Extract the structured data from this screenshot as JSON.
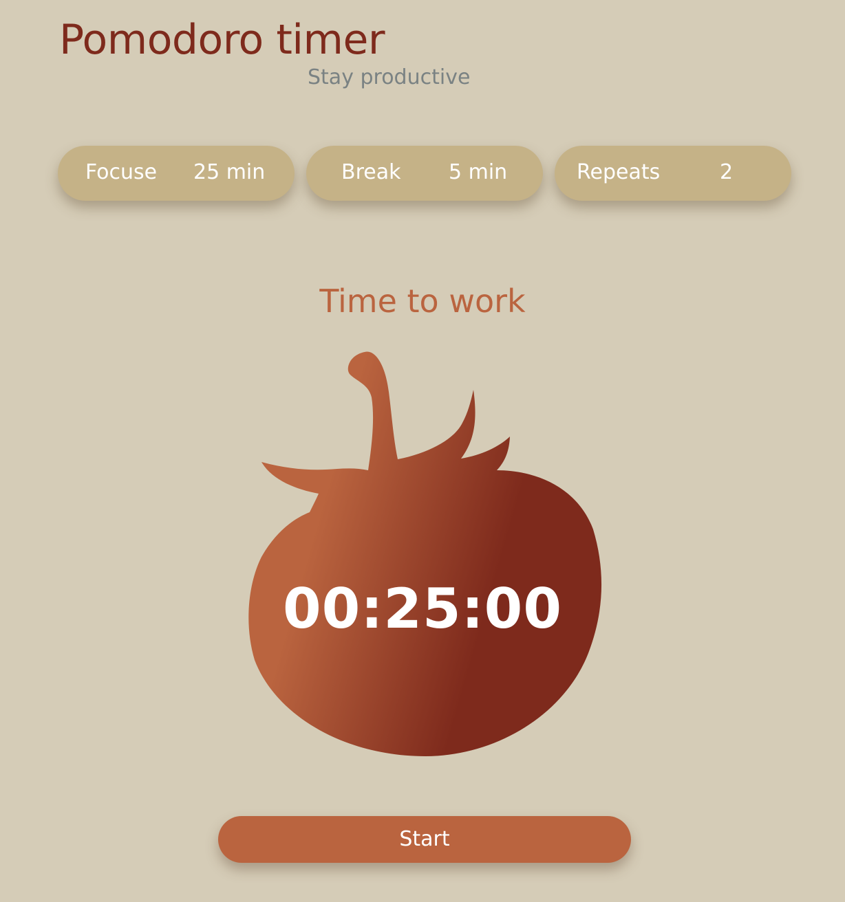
{
  "header": {
    "title": "Pomodoro timer",
    "subtitle": "Stay productive"
  },
  "settings": {
    "focus": {
      "label": "Focuse",
      "value": "25 min"
    },
    "break": {
      "label": "Break",
      "value": "5 min"
    },
    "repeats": {
      "label": "Repeats",
      "value": "2"
    }
  },
  "timer": {
    "status": "Time to work",
    "display": "00:25:00",
    "icon": "tomato-icon"
  },
  "controls": {
    "start_label": "Start"
  },
  "colors": {
    "background": "#d5ccb7",
    "title": "#7e2a1c",
    "subtitle": "#7a8283",
    "pill": "#c5b287",
    "accent": "#ba643f",
    "tomato_light": "#ba643f",
    "tomato_dark": "#7e2a1c"
  }
}
